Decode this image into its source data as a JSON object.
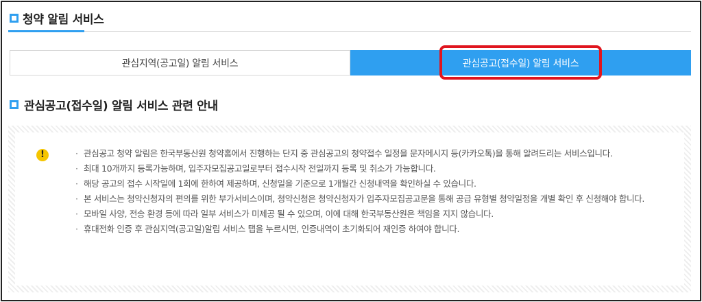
{
  "header": {
    "title": "청약 알림 서비스"
  },
  "tabs": [
    {
      "label": "관심지역(공고일) 알림 서비스",
      "active": false
    },
    {
      "label": "관심공고(접수일) 알림 서비스",
      "active": true
    }
  ],
  "section": {
    "title": "관심공고(접수일) 알림 서비스 관련 안내"
  },
  "notice": {
    "icon": "exclamation",
    "icon_glyph": "!",
    "items": [
      "관심공고 청약 알림은 한국부동산원 청약홈에서 진행하는 단지 중 관심공고의 청약접수 일정을 문자메시지 등(카카오톡)을 통해 알려드리는 서비스입니다.",
      "최대 10개까지 등록가능하며, 입주자모집공고일로부터 접수시작 전일까지 등록 및 취소가 가능합니다.",
      "해당 공고의 접수 시작일에 1회에 한하여 제공하며, 신청일을 기준으로 1개월간 신청내역을 확인하실 수 있습니다.",
      "본 서비스는 청약신청자의 편의를 위한 부가서비스이며, 청약신청은 청약신청자가 입주자모집공고문을 통해 공급 유형별 청약일정을 개별 확인 후 신청해야 합니다.",
      "모바일 사양, 전송 환경 등에 따라 일부 서비스가 미제공 될 수 있으며, 이에 대해 한국부동산원은 책임을 지지 않습니다.",
      "휴대전화 인증 후 관심지역(공고일)알림 서비스 탭을 누르시면, 인증내역이 초기화되어 재인증 하여야 합니다."
    ]
  },
  "colors": {
    "accent": "#2f9ff0",
    "highlight": "#e0151e",
    "warning": "#f5c500"
  }
}
